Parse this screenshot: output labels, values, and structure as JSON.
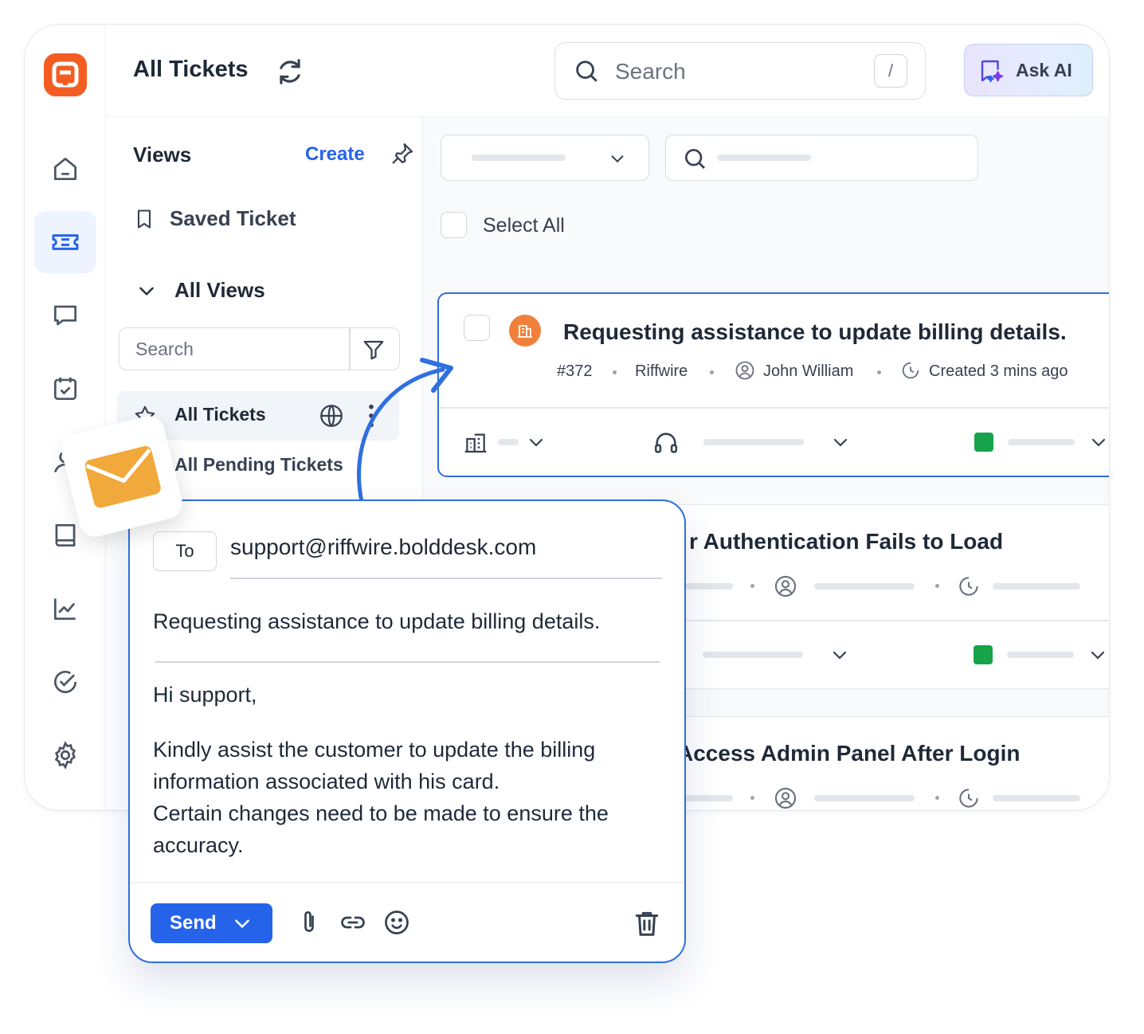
{
  "header": {
    "title": "All Tickets",
    "search_placeholder": "Search",
    "search_shortcut": "/",
    "ask_ai_label": "Ask AI"
  },
  "views": {
    "title": "Views",
    "create_label": "Create",
    "saved_label": "Saved Ticket",
    "all_views_label": "All Views",
    "search_placeholder": "Search",
    "items": [
      {
        "label": "All Tickets"
      },
      {
        "label": "All Pending Tickets"
      }
    ]
  },
  "tickets": {
    "select_all_label": "Select All",
    "list": [
      {
        "title": "Requesting assistance to update billing details.",
        "id": "#372",
        "company": "Riffwire",
        "contact": "John William",
        "created": "Created 3 mins ago"
      },
      {
        "title": "r Authentication Fails to Load"
      },
      {
        "title": "Access Admin Panel After Login"
      }
    ]
  },
  "compose": {
    "to_label": "To",
    "to_email": "support@riffwire.bolddesk.com",
    "subject": "Requesting assistance to update billing details.",
    "greeting": "Hi support,",
    "body_line1": "Kindly assist the customer to update the billing information associated with his card.",
    "body_line2": "Certain changes need to be made to ensure the accuracy.",
    "send_label": "Send"
  },
  "colors": {
    "brand": "#f45d22",
    "accent": "#2563eb",
    "status_green": "#16a34a",
    "org_badge": "#f0803c",
    "envelope": "#f2a93b"
  },
  "icons": {
    "rail": [
      "home-icon",
      "ticket-icon",
      "chat-icon",
      "calendar-check-icon",
      "contact-icon",
      "book-icon",
      "chart-icon",
      "check-circle-icon",
      "gear-icon"
    ]
  }
}
